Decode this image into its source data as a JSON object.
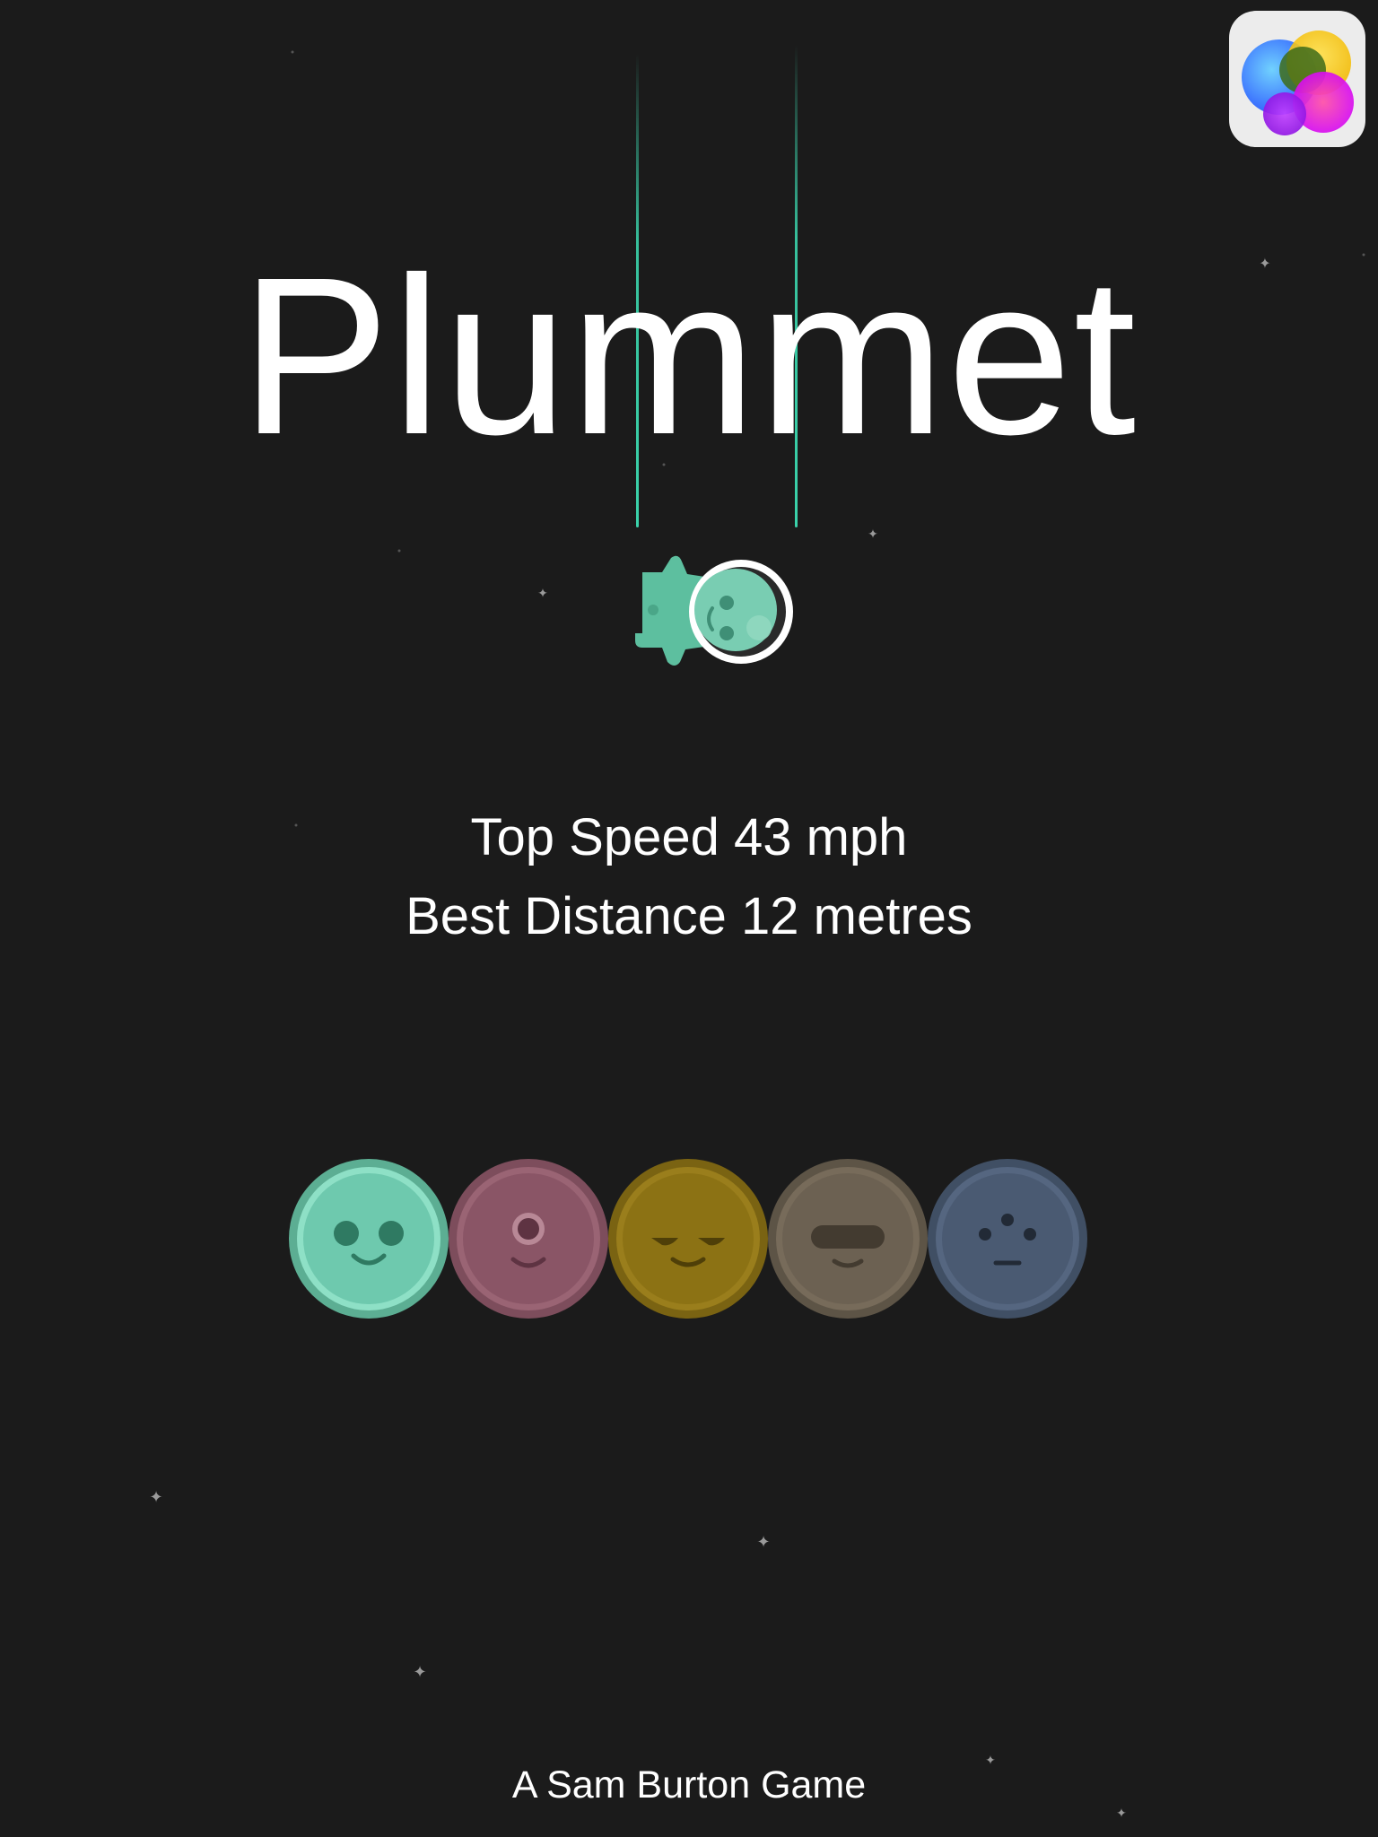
{
  "game": {
    "title": "Plummet",
    "stats": {
      "top_speed": "Top Speed 43 mph",
      "best_distance": "Best Distance 12 metres"
    },
    "credit": "A Sam Burton Game",
    "game_center_icon": "game-center-icon",
    "characters": [
      {
        "name": "green-character",
        "color": "#6ec9ae",
        "selected": true
      },
      {
        "name": "pink-character",
        "color": "#8a5566",
        "selected": false
      },
      {
        "name": "yellow-character",
        "color": "#8c7214",
        "selected": false
      },
      {
        "name": "tan-character",
        "color": "#6c6152",
        "selected": false
      },
      {
        "name": "blue-character",
        "color": "#4a5a72",
        "selected": false
      }
    ]
  }
}
